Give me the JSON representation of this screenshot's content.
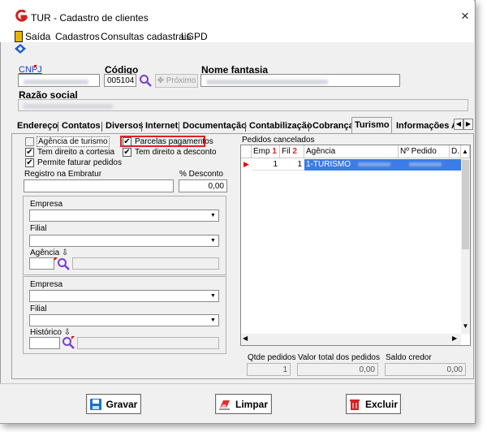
{
  "window": {
    "title": "TUR - Cadastro de clientes",
    "close_glyph": "×"
  },
  "menu": {
    "items": [
      "Saída",
      "Cadastros",
      "Consultas cadastrais",
      "LGPD"
    ]
  },
  "header": {
    "cnpj_label": "CNPJ",
    "codigo_label": "Código",
    "codigo_value": "005104",
    "proximo_label": "Próximo",
    "proximo_glyph": "✥",
    "nome_fantasia_label": "Nome fantasia",
    "razao_social_label": "Razão social"
  },
  "tabs": {
    "items": [
      "Endereço",
      "Contatos",
      "Diversos",
      "Internet",
      "Documentação",
      "Contabilização",
      "Cobrança",
      "Turismo",
      "Informações Ac"
    ],
    "active": "Turismo"
  },
  "turismo": {
    "agencia_turismo_label": "Agência de turismo",
    "cortesia_label": "Tem direito a cortesia",
    "faturar_label": "Permite faturar pedidos",
    "parcelas_label": "Parcelas pagamentos",
    "desconto_label": "Tem direito a desconto",
    "registro_label": "Registro na Embratur",
    "pct_desconto_label": "% Desconto",
    "pct_desconto_value": "0,00",
    "group1": {
      "empresa_label": "Empresa",
      "filial_label": "Filial",
      "agencia_label": "Agência"
    },
    "group2": {
      "empresa_label": "Empresa",
      "filial_label": "Filial",
      "historico_label": "Histórico"
    },
    "sort_glyph": "⇩"
  },
  "pedidos": {
    "title": "Pedidos cancelados",
    "columns": [
      "Emp",
      "Fil",
      "Agência",
      "Nº Pedido",
      "D."
    ],
    "sort_marks": [
      "1",
      "2"
    ],
    "row": {
      "emp": "1",
      "fil": "1",
      "agencia": "1-TURISMO"
    },
    "qtde_label": "Qtde pedidos",
    "qtde_value": "1",
    "valor_label": "Valor total dos pedidos",
    "valor_value": "0,00",
    "saldo_label": "Saldo credor",
    "saldo_value": "0,00"
  },
  "buttons": {
    "gravar": "Gravar",
    "limpar": "Limpar",
    "excluir": "Excluir"
  },
  "colors": {
    "accent_red": "#e02020",
    "selection_blue": "#3b7ce6",
    "link_blue": "#1a3fd0"
  }
}
